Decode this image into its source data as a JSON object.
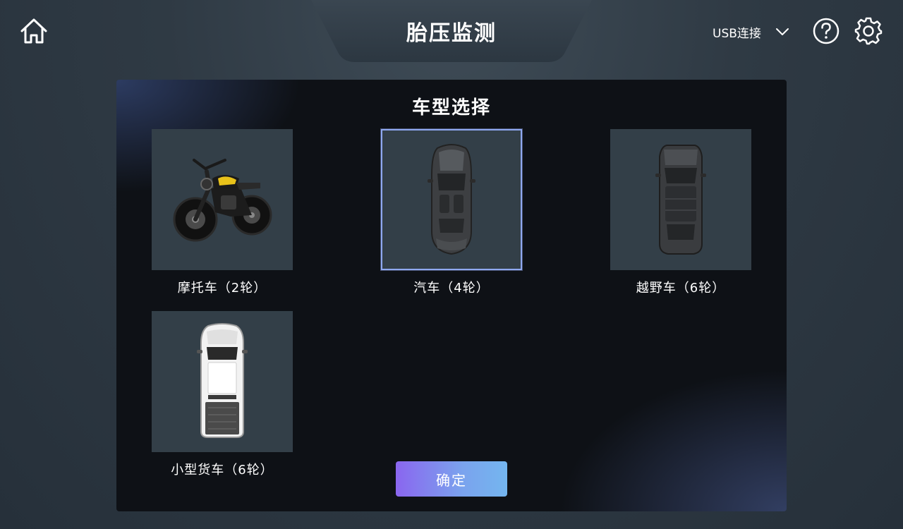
{
  "header": {
    "title": "胎压监测",
    "home_icon": "home-icon",
    "connection": {
      "selected": "USB连接",
      "icon": "chevron-down-icon"
    },
    "help_icon": "help-icon",
    "settings_icon": "settings-icon"
  },
  "panel": {
    "title": "车型选择",
    "vehicles": [
      {
        "label": "摩托车（2轮）",
        "icon": "motorcycle-icon",
        "selected": false
      },
      {
        "label": "汽车（4轮）",
        "icon": "car-icon",
        "selected": true
      },
      {
        "label": "越野车（6轮）",
        "icon": "suv-icon",
        "selected": false
      },
      {
        "label": "小型货车（6轮）",
        "icon": "pickup-truck-icon",
        "selected": false
      }
    ],
    "confirm_label": "确定"
  },
  "colors": {
    "selected_border": "#8fa8f0",
    "button_gradient_start": "#8a66ef",
    "button_gradient_end": "#74b6ef"
  }
}
